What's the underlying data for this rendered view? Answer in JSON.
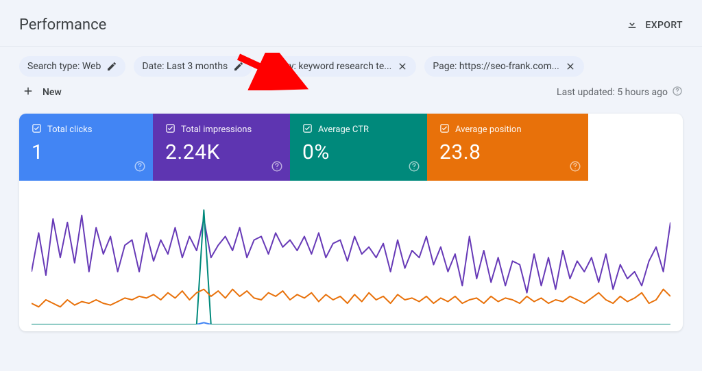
{
  "header": {
    "title": "Performance",
    "export_label": "EXPORT"
  },
  "filters": {
    "search_type": "Search type: Web",
    "date": "Date: Last 3 months",
    "query": "Query: keyword research te...",
    "page": "Page: https://seo-frank.com..."
  },
  "new_label": "New",
  "last_updated": "Last updated: 5 hours ago",
  "metrics": {
    "clicks": {
      "label": "Total clicks",
      "value": "1"
    },
    "impressions": {
      "label": "Total impressions",
      "value": "2.24K"
    },
    "ctr": {
      "label": "Average CTR",
      "value": "0%"
    },
    "position": {
      "label": "Average position",
      "value": "23.8"
    }
  },
  "chart_data": {
    "type": "line",
    "x": [
      0,
      1,
      2,
      3,
      4,
      5,
      6,
      7,
      8,
      9,
      10,
      11,
      12,
      13,
      14,
      15,
      16,
      17,
      18,
      19,
      20,
      21,
      22,
      23,
      24,
      25,
      26,
      27,
      28,
      29,
      30,
      31,
      32,
      33,
      34,
      35,
      36,
      37,
      38,
      39,
      40,
      41,
      42,
      43,
      44,
      45,
      46,
      47,
      48,
      49,
      50,
      51,
      52,
      53,
      54,
      55,
      56,
      57,
      58,
      59,
      60,
      61,
      62,
      63,
      64,
      65,
      66,
      67,
      68,
      69,
      70,
      71,
      72,
      73,
      74,
      75,
      76,
      77,
      78,
      79,
      80,
      81,
      82,
      83,
      84,
      85,
      86,
      87,
      88,
      89
    ],
    "series": [
      {
        "name": "Clicks",
        "color": "#4285f4",
        "values": [
          0,
          0,
          0,
          0,
          0,
          0,
          0,
          0,
          0,
          0,
          0,
          0,
          0,
          0,
          0,
          0,
          0,
          0,
          0,
          0,
          0,
          0,
          0,
          0,
          1,
          0,
          0,
          0,
          0,
          0,
          0,
          0,
          0,
          0,
          0,
          0,
          0,
          0,
          0,
          0,
          0,
          0,
          0,
          0,
          0,
          0,
          0,
          0,
          0,
          0,
          0,
          0,
          0,
          0,
          0,
          0,
          0,
          0,
          0,
          0,
          0,
          0,
          0,
          0,
          0,
          0,
          0,
          0,
          0,
          0,
          0,
          0,
          0,
          0,
          0,
          0,
          0,
          0,
          0,
          0,
          0,
          0,
          0,
          0,
          0,
          0,
          0,
          0,
          0,
          0
        ]
      },
      {
        "name": "Impressions",
        "color": "#673ab7",
        "values": [
          30,
          52,
          28,
          60,
          38,
          58,
          35,
          62,
          30,
          55,
          40,
          50,
          30,
          45,
          48,
          30,
          52,
          36,
          48,
          40,
          55,
          38,
          50,
          42,
          60,
          38,
          45,
          50,
          42,
          55,
          38,
          48,
          50,
          40,
          52,
          44,
          48,
          42,
          50,
          40,
          52,
          38,
          46,
          48,
          36,
          50,
          40,
          44,
          38,
          46,
          30,
          48,
          32,
          42,
          38,
          50,
          34,
          44,
          30,
          40,
          22,
          50,
          26,
          42,
          24,
          38,
          22,
          36,
          34,
          18,
          40,
          22,
          38,
          20,
          42,
          26,
          36,
          30,
          38,
          24,
          40,
          20,
          34,
          26,
          30,
          22,
          36,
          44,
          30,
          58
        ]
      },
      {
        "name": "CTR",
        "color": "#00897b",
        "values": [
          0,
          0,
          0,
          0,
          0,
          0,
          0,
          0,
          0,
          0,
          0,
          0,
          0,
          0,
          0,
          0,
          0,
          0,
          0,
          0,
          0,
          0,
          0,
          0,
          65,
          0,
          0,
          0,
          0,
          0,
          0,
          0,
          0,
          0,
          0,
          0,
          0,
          0,
          0,
          0,
          0,
          0,
          0,
          0,
          0,
          0,
          0,
          0,
          0,
          0,
          0,
          0,
          0,
          0,
          0,
          0,
          0,
          0,
          0,
          0,
          0,
          0,
          0,
          0,
          0,
          0,
          0,
          0,
          0,
          0,
          0,
          0,
          0,
          0,
          0,
          0,
          0,
          0,
          0,
          0,
          0,
          0,
          0,
          0,
          0,
          0,
          0,
          0,
          0,
          0
        ]
      },
      {
        "name": "Position",
        "color": "#e8710a",
        "values": [
          12,
          10,
          14,
          12,
          10,
          14,
          11,
          13,
          12,
          14,
          12,
          11,
          13,
          15,
          14,
          16,
          15,
          17,
          14,
          18,
          15,
          19,
          14,
          18,
          20,
          16,
          19,
          15,
          20,
          16,
          19,
          15,
          14,
          18,
          16,
          19,
          14,
          17,
          15,
          18,
          13,
          17,
          14,
          16,
          12,
          17,
          13,
          18,
          14,
          16,
          12,
          17,
          14,
          15,
          13,
          16,
          12,
          15,
          13,
          16,
          12,
          14,
          15,
          12,
          16,
          13,
          15,
          14,
          12,
          16,
          13,
          15,
          12,
          14,
          13,
          16,
          14,
          12,
          15,
          18,
          14,
          12,
          16,
          13,
          15,
          18,
          12,
          14,
          20,
          16
        ]
      }
    ],
    "ylim": [
      0,
      70
    ]
  }
}
